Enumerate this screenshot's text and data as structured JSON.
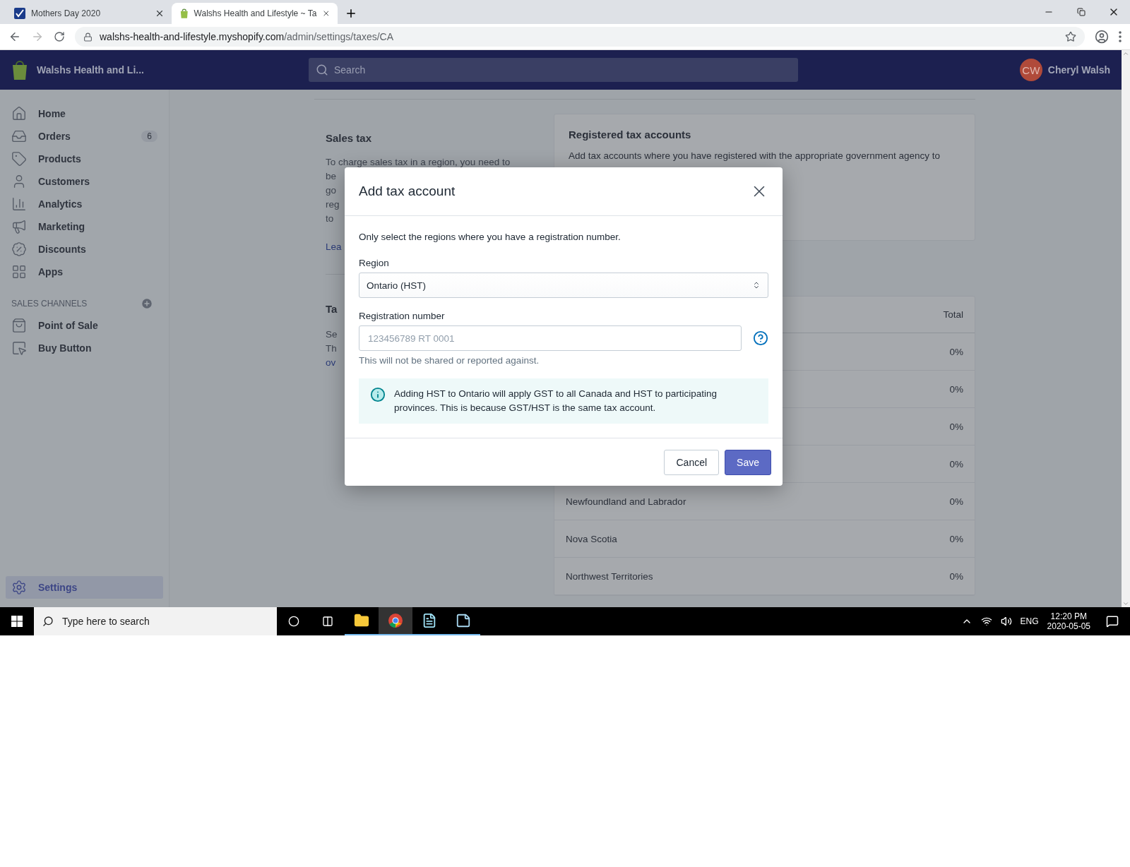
{
  "browser": {
    "tabs": [
      {
        "title": "Mothers Day 2020",
        "kind": "checkmark",
        "selected": false
      },
      {
        "title": "Walshs Health and Lifestyle ~ Ta",
        "kind": "shop",
        "selected": true
      }
    ],
    "url": {
      "host": "walshs-health-and-lifestyle.myshopify.com",
      "path": "/admin/settings/taxes/CA"
    }
  },
  "topbar": {
    "store_name": "Walshs Health and Li...",
    "search_placeholder": "Search",
    "user": {
      "initials": "CW",
      "name": "Cheryl Walsh"
    }
  },
  "sidebar": {
    "items": [
      {
        "label": "Home",
        "kind": "home",
        "selected": false
      },
      {
        "label": "Orders",
        "kind": "orders",
        "badge": "6",
        "selected": false
      },
      {
        "label": "Products",
        "kind": "products",
        "selected": false
      },
      {
        "label": "Customers",
        "kind": "customers",
        "selected": false
      },
      {
        "label": "Analytics",
        "kind": "analytics",
        "selected": false
      },
      {
        "label": "Marketing",
        "kind": "marketing",
        "selected": false
      },
      {
        "label": "Discounts",
        "kind": "discounts",
        "selected": false
      },
      {
        "label": "Apps",
        "kind": "apps",
        "selected": false
      }
    ],
    "channels_heading": "SALES CHANNELS",
    "channels": [
      {
        "label": "Point of Sale",
        "kind": "pos",
        "selected": false
      },
      {
        "label": "Buy Button",
        "kind": "buy_button",
        "selected": false
      }
    ],
    "footer": [
      {
        "label": "Settings",
        "kind": "settings",
        "selected": true
      }
    ]
  },
  "sales_tax": {
    "title": "Sales tax",
    "lines": [
      "To charge sales tax in a region, you need to",
      "be",
      "go",
      "reg",
      "to"
    ],
    "link": "Lea"
  },
  "tax_section": {
    "title": "Ta",
    "lines": [
      "Se",
      "Th"
    ],
    "link": "ov"
  },
  "registered_card": {
    "title": "Registered tax accounts",
    "description": "Add tax accounts where you have registered with the appropriate government agency to"
  },
  "table": {
    "columns": [
      "Total"
    ],
    "rows": [
      {
        "total": "0%"
      },
      {
        "total": "0%"
      },
      {
        "total": "0%"
      },
      {
        "total": "0%"
      },
      {
        "name": "Newfoundland and Labrador",
        "total": "0%"
      },
      {
        "name": "Nova Scotia",
        "total": "0%"
      },
      {
        "name": "Northwest Territories",
        "total": "0%"
      }
    ]
  },
  "modal": {
    "title": "Add tax account",
    "intro": "Only select the regions where you have a registration number.",
    "region_label": "Region",
    "region_value": "Ontario (HST)",
    "registration_label": "Registration number",
    "registration_placeholder": "123456789 RT 0001",
    "hint": "This will not be shared or reported against.",
    "info": "Adding HST to Ontario will apply GST to all Canada and HST to participating provinces. This is because GST/HST is the same tax account.",
    "buttons": [
      {
        "label": "Cancel",
        "kind": "secondary"
      },
      {
        "label": "Save",
        "kind": "primary"
      }
    ]
  },
  "taskbar": {
    "search_placeholder": "Type here to search",
    "apps": [
      {
        "kind": "folder",
        "selected": false
      },
      {
        "kind": "browser",
        "selected": true
      },
      {
        "kind": "document",
        "selected": false
      },
      {
        "kind": "notepad",
        "selected": false
      }
    ],
    "language": "ENG",
    "time": "12:20 PM",
    "date": "2020-05-05"
  }
}
